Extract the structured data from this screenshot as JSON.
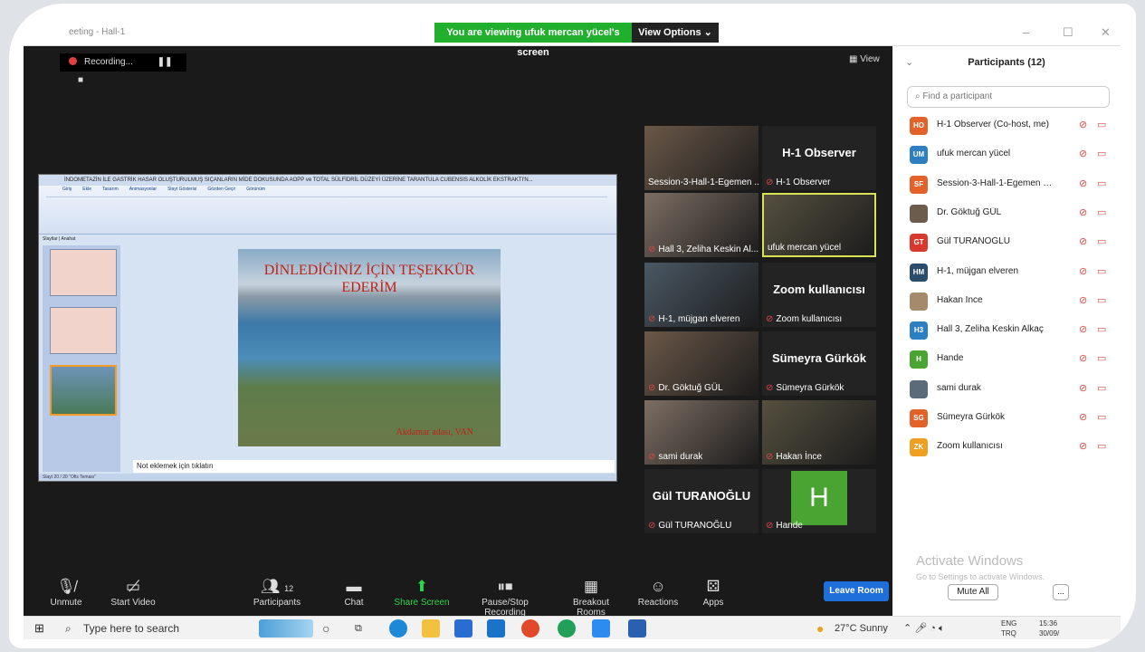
{
  "window": {
    "title": "eeting - Hall-1",
    "viewing_banner": "You are viewing ufuk mercan yücel's screen",
    "view_options": "View Options",
    "recording": "Recording...",
    "view_button": "View"
  },
  "shared_slide": {
    "window_title": "İNDOMETAZİN İLE GASTRİK HASAR OLUŞTURULMUŞ SIÇANLARIN MİDE DOKUSUNDA AOPP ve TOTAL SÜLFİDRİL DÜZEYİ ÜZERİNE TARANTULA CUBENSIS ALKOLİK EKSTRAKTI'N...",
    "ribbon_tabs": [
      "Giriş",
      "Ekle",
      "Tasarım",
      "Animasyonlar",
      "Slayt Gösterisi",
      "Gözden Geçir",
      "Görünüm"
    ],
    "side_tabs": [
      "Slaytlar",
      "Anahat"
    ],
    "heading": "DİNLEDİĞİNİZ İÇİN TEŞEKKÜR EDERİM",
    "caption": "Akdamar adası, VAN",
    "notes_placeholder": "Not eklemek için tıklatın",
    "status": "Slayt 20 / 20   \"Ofis Teması\""
  },
  "video_tiles": [
    {
      "name": "Session-3-Hall-1-Egemen ...",
      "kind": "video",
      "muted": false
    },
    {
      "name": "H-1 Observer",
      "kind": "label",
      "big": "H-1 Observer",
      "muted": true
    },
    {
      "name": "Hall 3, Zeliha Keskin Al...",
      "kind": "video",
      "muted": true
    },
    {
      "name": "ufuk mercan yücel",
      "kind": "video",
      "muted": false,
      "active": true
    },
    {
      "name": "H-1, müjgan elveren",
      "kind": "video",
      "muted": true
    },
    {
      "name": "Zoom kullanıcısı",
      "kind": "label",
      "big": "Zoom kullanıcısı",
      "muted": true
    },
    {
      "name": "Dr. Göktuğ GÜL",
      "kind": "video",
      "muted": true
    },
    {
      "name": "Sümeyra Gürkök",
      "kind": "label",
      "big": "Sümeyra Gürkök",
      "muted": true
    },
    {
      "name": "sami durak",
      "kind": "video",
      "muted": true
    },
    {
      "name": "Hakan İnce",
      "kind": "video",
      "muted": true
    },
    {
      "name": "Gül TURANOĞLU",
      "kind": "label",
      "big": "Gül TURANOĞLU",
      "muted": true
    },
    {
      "name": "Hande",
      "kind": "avatar",
      "big": "H",
      "muted": true
    }
  ],
  "participants_panel": {
    "title": "Participants (12)",
    "search_placeholder": "Find a participant",
    "participants": [
      {
        "initials": "HO",
        "color": "#e2622a",
        "name": "H-1 Observer (Co-host, me)"
      },
      {
        "initials": "UM",
        "color": "#2d7fc4",
        "name": "ufuk mercan yücel"
      },
      {
        "initials": "SF",
        "color": "#e2622a",
        "name": "Session-3-Hall-1-Egemen FOT..."
      },
      {
        "initials": "",
        "color": "#6b5c4e",
        "name": "Dr. Göktuğ GÜL"
      },
      {
        "initials": "GT",
        "color": "#d9382e",
        "name": "Gül TURANOĞLU"
      },
      {
        "initials": "HM",
        "color": "#2a4d6e",
        "name": "H-1, müjgan elveren"
      },
      {
        "initials": "",
        "color": "#a58b6c",
        "name": "Hakan İnce"
      },
      {
        "initials": "H3",
        "color": "#2d7fc4",
        "name": "Hall 3, Zeliha Keskin Alkaç"
      },
      {
        "initials": "H",
        "color": "#4aa432",
        "name": "Hande"
      },
      {
        "initials": "",
        "color": "#5c6b7a",
        "name": "sami durak"
      },
      {
        "initials": "SG",
        "color": "#e2622a",
        "name": "Sümeyra Gürkök"
      },
      {
        "initials": "ZK",
        "color": "#f0a020",
        "name": "Zoom kullanıcısı"
      }
    ],
    "activate_title": "Activate Windows",
    "activate_sub": "Go to Settings to activate Windows.",
    "mute_all": "Mute All",
    "more": "..."
  },
  "toolbar": {
    "unmute": "Unmute",
    "start_video": "Start Video",
    "participants": "Participants",
    "participants_count": "12",
    "chat": "Chat",
    "share_screen": "Share Screen",
    "pause_stop_recording": "Pause/Stop Recording",
    "breakout_rooms": "Breakout Rooms",
    "reactions": "Reactions",
    "apps": "Apps",
    "leave_room": "Leave Room"
  },
  "taskbar": {
    "search_placeholder": "Type here to search",
    "weather": "27°C  Sunny",
    "lang1": "ENG",
    "lang2": "TRQ",
    "time": "15:36",
    "date": "30/09/"
  }
}
